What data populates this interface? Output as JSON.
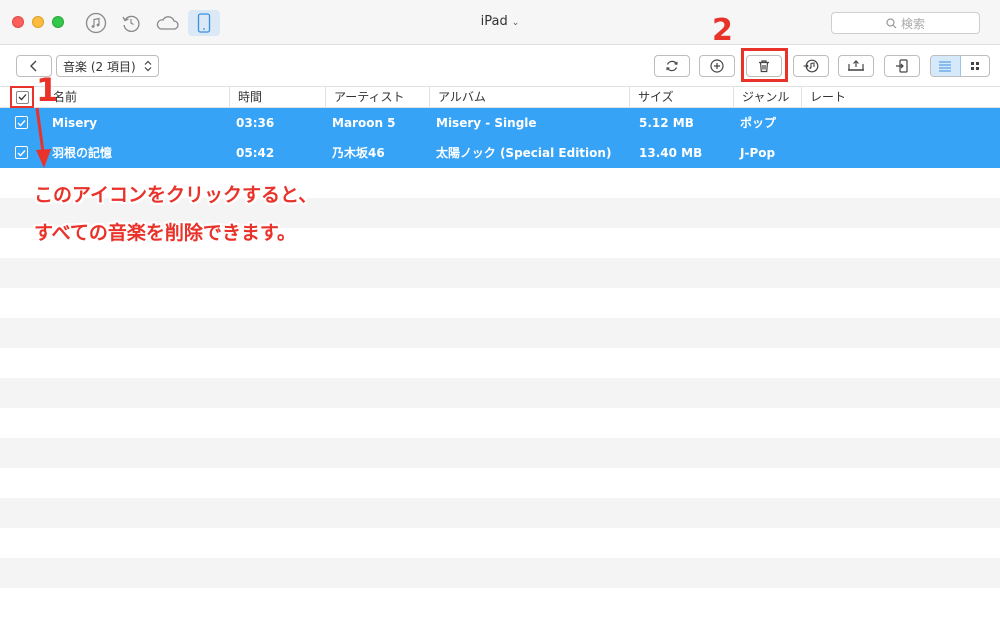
{
  "window": {
    "device_title": "iPad",
    "search_placeholder": "検索"
  },
  "nav_icons": [
    "music-icon",
    "history-icon",
    "cloud-icon",
    "ipad-icon"
  ],
  "toolbar": {
    "category_label": "音楽 (2 項目)",
    "tools": [
      "refresh-icon",
      "add-icon",
      "trash-icon",
      "to-itunes-icon",
      "to-computer-icon",
      "to-device-icon"
    ],
    "views": [
      "list-view-icon",
      "grid-view-icon"
    ]
  },
  "columns": [
    "名前",
    "時間",
    "アーティスト",
    "アルバム",
    "サイズ",
    "ジャンル",
    "レート"
  ],
  "songs": [
    {
      "name": "Misery",
      "time": "03:36",
      "artist": "Maroon 5",
      "album": "Misery - Single",
      "size": "5.12 MB",
      "genre": "ポップ",
      "rate": ""
    },
    {
      "name": "羽根の記憶",
      "time": "05:42",
      "artist": "乃木坂46",
      "album": "太陽ノック (Special Edition)",
      "size": "13.40 MB",
      "genre": "J-Pop",
      "rate": ""
    }
  ],
  "annotations": {
    "step1": "1",
    "step2": "2",
    "line1": "このアイコンをクリックすると、",
    "line2": "すべての音楽を削除できます。"
  },
  "colors": {
    "selection": "#36a3f7",
    "annotation": "#e8322a",
    "stripe": "#f4f4f4"
  }
}
